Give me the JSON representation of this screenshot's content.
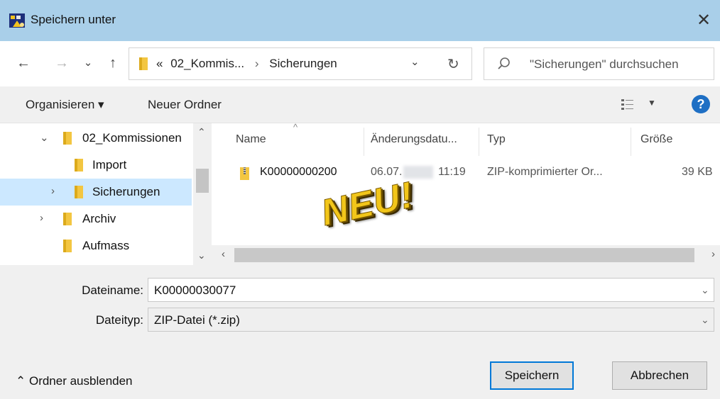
{
  "window": {
    "title": "Speichern unter",
    "close": "✕"
  },
  "nav": {
    "back": "←",
    "forward": "→",
    "recent": "⌄",
    "up": "↑",
    "address": {
      "prefix": "«",
      "crumbs": [
        "02_Kommis...",
        "Sicherungen"
      ],
      "separator": "›",
      "dropdown": "⌄",
      "refresh": "↻"
    },
    "search_placeholder": "\"Sicherungen\" durchsuchen"
  },
  "toolbar": {
    "organize": "Organisieren ▾",
    "new_folder": "Neuer Ordner",
    "help": "?"
  },
  "tree": [
    {
      "label": "02_Kommissionen",
      "chevron": "⌄",
      "indent": 1,
      "selected": false
    },
    {
      "label": "Import",
      "chevron": "",
      "indent": 2,
      "selected": false
    },
    {
      "label": "Sicherungen",
      "chevron": "›",
      "indent": 2,
      "selected": true
    },
    {
      "label": "Archiv",
      "chevron": "›",
      "indent": 1,
      "selected": false
    },
    {
      "label": "Aufmass",
      "chevron": "",
      "indent": 1,
      "selected": false
    }
  ],
  "columns": {
    "name": "Name",
    "date": "Änderungsdatu...",
    "type": "Typ",
    "size": "Größe"
  },
  "files": [
    {
      "name": "K00000000200",
      "date_prefix": "06.07.",
      "time": "11:19",
      "type": "ZIP-komprimierter Or...",
      "size": "39 KB"
    }
  ],
  "overlay": "NEU!",
  "form": {
    "filename_label": "Dateiname:",
    "filename_value": "K00000030077",
    "filetype_label": "Dateityp:",
    "filetype_value": "ZIP-Datei (*.zip)"
  },
  "footer": {
    "hide_folders": "⌃ Ordner ausblenden",
    "save": "Speichern",
    "cancel": "Abbrechen"
  },
  "colors": {
    "titlebar": "#a9cfe9",
    "selection": "#cce8ff",
    "accent": "#0078d7",
    "folder": "#f3c641",
    "overlay_text": "#f2c61a"
  }
}
